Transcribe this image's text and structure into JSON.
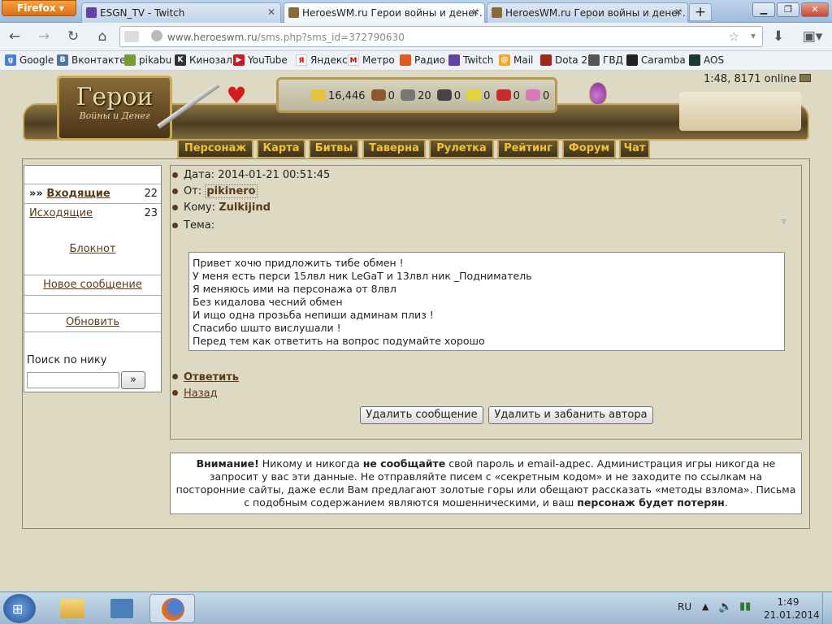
{
  "browser": {
    "app_button": "Firefox",
    "tabs": [
      {
        "title": "ESGN_TV - Twitch",
        "active": false
      },
      {
        "title": "HeroesWM.ru Герои войны и денег. ...",
        "active": true
      },
      {
        "title": "HeroesWM.ru Герои войны и денег. ...",
        "active": false
      }
    ],
    "new_tab": "+",
    "url_host": "www.heroeswm.ru",
    "url_path": "/sms.php?sms_id=372790630",
    "bookmarks": [
      "Google",
      "Вконтакте",
      "pikabu",
      "Кинозал",
      "YouTube",
      "Яндекс",
      "Метро",
      "Радио",
      "Twitch",
      "Mail",
      "Dota 2",
      "ГВД",
      "Caramba",
      "AOS"
    ]
  },
  "header": {
    "logo_title": "Герои",
    "logo_subtitle": "Войны и Денег",
    "online_status": "1:48, 8171 online",
    "resources": [
      "16,446",
      "0",
      "20",
      "0",
      "0",
      "0",
      "0"
    ],
    "menu": [
      "Персонаж",
      "Карта",
      "Битвы",
      "Таверна",
      "Рулетка",
      "Рейтинг",
      "Форум",
      "Чат"
    ]
  },
  "sidebar": {
    "inbox_label": "Входящие",
    "inbox_prefix": "»»",
    "inbox_count": "22",
    "outbox_label": "Исходящие",
    "outbox_count": "23",
    "notepad": "Блокнот",
    "new_message": "Новое сообщение",
    "refresh": "Обновить",
    "search_label": "Поиск по нику",
    "search_button": "»"
  },
  "message": {
    "date_label": "Дата:",
    "date_value": "2014-01-21 00:51:45",
    "from_label": "От:",
    "from_value": "pikinero",
    "to_label": "Кому:",
    "to_value": "Zulkijind",
    "subject_label": "Тема:",
    "body": [
      "Привет хочю придложить тибе обмен !",
      "У меня есть перси 15лвл ник LeGaT и 13лвл ник _Подниматель",
      "Я меняюсь ими на персонажа от 8лвл",
      "Без кидалова чесний обмен",
      "И ищо одна прозьба непиши админам плиз !",
      "Спасибо шшто вислушали !",
      "Перед тем как ответить на вопрос подумайте хорошо"
    ],
    "reply": "Ответить",
    "back": "Назад",
    "delete_button": "Удалить сообщение",
    "delete_ban_button": "Удалить и забанить автора"
  },
  "warning": {
    "strong1": "Внимание!",
    "text1": " Никому и никогда ",
    "strong2": "не сообщайте",
    "text2": " свой пароль и email-адрес. Администрация игры никогда не запросит у вас эти данные. Не отправляйте писем с «секретным кодом» и не заходите по ссылкам на посторонние сайты, даже если Вам предлагают золотые горы или обещают рассказать «методы взлома». Письма с подобным содержанием являются мошенническими, и ваш ",
    "strong3": "персонаж будет потерян",
    "text3": "."
  },
  "taskbar": {
    "lang": "RU",
    "time": "1:49",
    "date": "21.01.2014"
  }
}
